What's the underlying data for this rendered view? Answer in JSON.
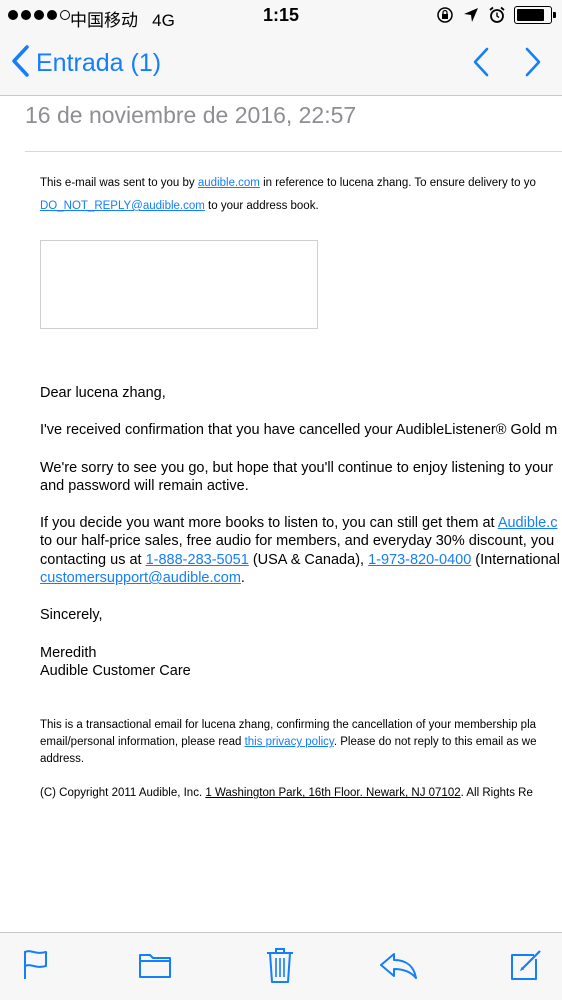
{
  "status_bar": {
    "carrier": "中国移动",
    "network": "4G",
    "time": "1:15",
    "battery_level": 0.85
  },
  "nav": {
    "back_label": "Entrada (1)"
  },
  "email": {
    "date": "16 de noviembre de 2016, 22:57",
    "header_line1_before": "This e-mail was sent to you by ",
    "header_link1": "audible.com",
    "header_line1_after": " in reference to lucena zhang. To ensure delivery to yo",
    "header_link2": "DO_NOT_REPLY@audible.com",
    "header_line2_after": " to your address book.",
    "greeting": "Dear lucena zhang,",
    "para1": "I've received confirmation that you have cancelled your AudibleListener® Gold m",
    "para2_line1": "We're sorry to see you go, but hope that you'll continue to enjoy listening to your",
    "para2_line2": "and password will remain active.",
    "para3_line1_before": "If you decide you want more books to listen to, you can still get them at ",
    "para3_link1": "Audible.c",
    "para3_line2": "to our half-price sales, free audio for members, and everyday 30% discount, you",
    "para3_line3_before": "contacting us at ",
    "para3_phone1": "1-888-283-5051",
    "para3_line3_mid": " (USA & Canada), ",
    "para3_phone2": "1-973-820-0400",
    "para3_line3_after": " (International",
    "para3_email": "customersupport@audible.com",
    "para3_line4_after": ".",
    "closing": "Sincerely,",
    "signer": "Meredith",
    "signer_title": "Audible Customer Care",
    "footer1_line1": "This is a transactional email for lucena zhang, confirming the cancellation of your membership pla",
    "footer1_line2_before": "email/personal information, please read ",
    "footer1_link": "this privacy policy",
    "footer1_line2_after": ". Please do not reply to this email as we",
    "footer1_line3": "address.",
    "copyright_before": "(C) Copyright 2011 Audible, Inc. ",
    "copyright_address": "1 Washington Park, 16th Floor. Newark, NJ 07102",
    "copyright_after": ". All Rights Re"
  },
  "toolbar": {
    "icons": [
      "flag-icon",
      "folder-icon",
      "trash-icon",
      "reply-icon",
      "compose-icon"
    ]
  },
  "colors": {
    "accent": "#147efb",
    "bar_bg": "#f7f7f7",
    "date_gray": "#8e8e93"
  }
}
